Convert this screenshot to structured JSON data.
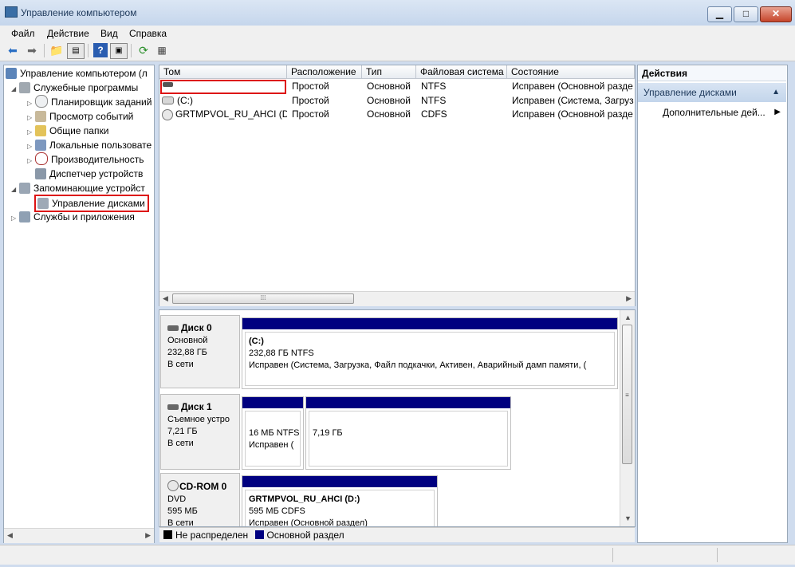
{
  "window": {
    "title": "Управление компьютером",
    "minimize_label": "▁",
    "maximize_label": "□",
    "close_label": "✕"
  },
  "menu": [
    "Файл",
    "Действие",
    "Вид",
    "Справка"
  ],
  "toolbar": {
    "icons": [
      "back-icon",
      "forward-icon",
      "up-folder-icon",
      "show-tree-icon",
      "help-icon",
      "console-icon",
      "refresh-icon",
      "properties-icon"
    ]
  },
  "tree": {
    "root": "Управление компьютером (л",
    "system_tools": "Служебные программы",
    "task_scheduler": "Планировщик заданий",
    "event_viewer": "Просмотр событий",
    "shared_folders": "Общие папки",
    "local_users": "Локальные пользовате",
    "performance": "Производительность",
    "device_manager": "Диспетчер устройств",
    "storage": "Запоминающие устройст",
    "disk_management": "Управление дисками",
    "services": "Службы и приложения"
  },
  "volumes": {
    "columns": [
      "Том",
      "Расположение",
      "Тип",
      "Файловая система",
      "Состояние"
    ],
    "rows": [
      [
        "",
        "Простой",
        "Основной",
        "NTFS",
        "Исправен (Основной разде"
      ],
      [
        "(C:)",
        "Простой",
        "Основной",
        "NTFS",
        "Исправен (Система, Загруз"
      ],
      [
        "GRTMPVOL_RU_AHCI (D:)",
        "Простой",
        "Основной",
        "CDFS",
        "Исправен (Основной разде"
      ]
    ]
  },
  "disks": {
    "disk0": {
      "name": "Диск 0",
      "type": "Основной",
      "size": "232,88 ГБ",
      "status": "В сети",
      "part": {
        "title": "(C:)",
        "line1": "232,88 ГБ NTFS",
        "line2": "Исправен (Система, Загрузка, Файл подкачки, Активен, Аварийный дамп памяти, ("
      }
    },
    "disk1": {
      "name": "Диск 1",
      "type": "Съемное устро",
      "size": "7,21 ГБ",
      "status": "В сети",
      "part1": {
        "line1": "16 МБ NTFS",
        "line2": "Исправен ("
      },
      "part2": {
        "line1": "7,19 ГБ"
      }
    },
    "cdrom0": {
      "name": "CD-ROM 0",
      "type": "DVD",
      "size": "595 МБ",
      "status": "В сети",
      "part": {
        "title": "GRTMPVOL_RU_AHCI (D:)",
        "line1": "595 МБ CDFS",
        "line2": "Исправен (Основной раздел)"
      }
    }
  },
  "legend": {
    "unallocated": "Не распределен",
    "primary": "Основной раздел"
  },
  "actions": {
    "title": "Действия",
    "section": "Управление дисками",
    "more": "Дополнительные дей..."
  },
  "colors": {
    "primary_partition": "#000080",
    "unallocated": "#000000",
    "highlight": "#dd1111"
  }
}
